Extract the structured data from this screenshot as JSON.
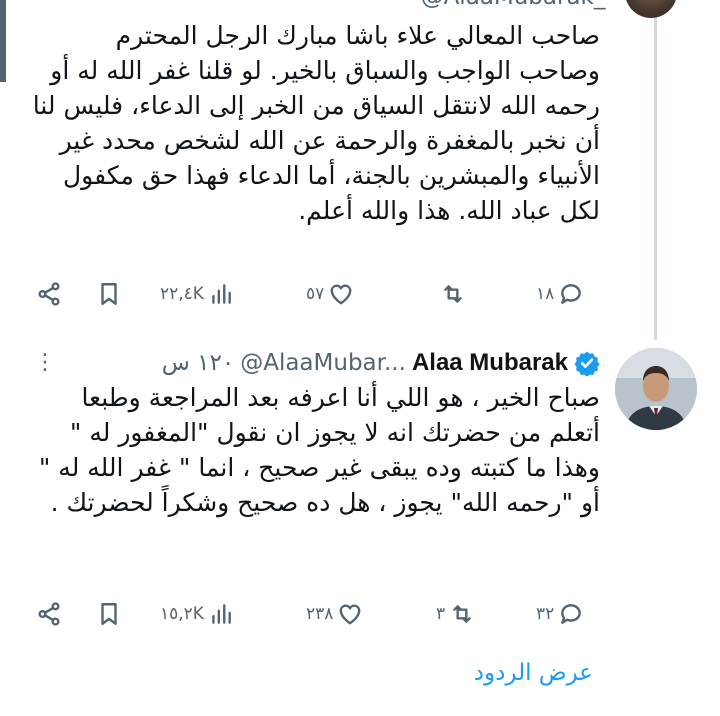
{
  "top_tweet": {
    "handle_partial": "@AlaaMubarak_ · ",
    "text": "صاحب المعالي علاء باشا مبارك الرجل المحترم وصاحب الواجب والسباق بالخير. لو قلنا غفر الله له أو رحمه الله لانتقل السياق من الخبر إلى الدعاء، فليس لنا أن نخبر بالمغفرة والرحمة عن الله لشخص محدد غير الأنبياء والمبشرين بالجنة، أما الدعاء فهذا حق مكفول لكل عباد الله. هذا والله أعلم.",
    "replies": "١٨",
    "retweets": "",
    "likes": "٥٧",
    "views": "٢٢,٤K"
  },
  "reply_tweet": {
    "author_name": "Alaa Mubarak",
    "handle": "@AlaaMubar...",
    "time": "١٢٠ س",
    "verified": true,
    "text": "صباح الخير ، هو اللي أنا اعرفه بعد المراجعة وطبعا أتعلم من حضرتك انه لا يجوز ان نقول \"المغفور له \" وهذا ما كتبته وده يبقى غير صحيح ، انما \" غفر الله له \" أو \"رحمه الله\" يجوز ، هل ده صحيح وشكراً لحضرتك .",
    "replies": "٣٢",
    "retweets": "٣",
    "likes": "٢٣٨",
    "views": "١٥,٢K"
  },
  "footer": {
    "view_replies": "عرض الردود"
  },
  "colors": {
    "accent": "#1d9bf0",
    "muted": "#536471",
    "text": "#0f1419",
    "thread_line": "#cfd9de"
  },
  "icons": [
    "share-icon",
    "bookmark-icon",
    "views-icon",
    "like-icon",
    "retweet-icon",
    "reply-icon",
    "verified-badge-icon",
    "more-icon"
  ]
}
